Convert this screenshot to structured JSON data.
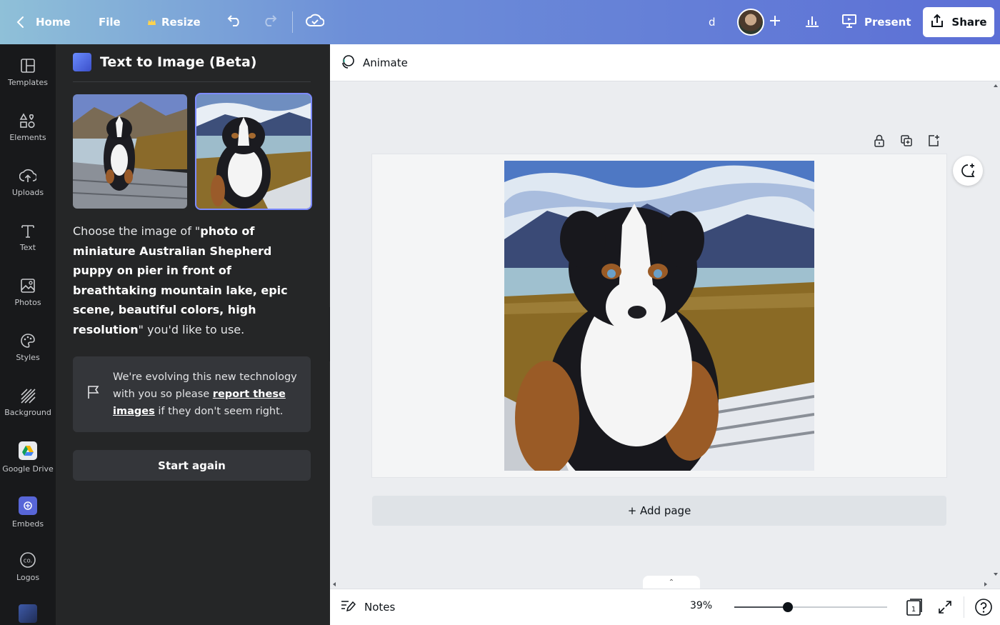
{
  "topbar": {
    "home": "Home",
    "file": "File",
    "resize": "Resize",
    "collaborator_initial": "d",
    "present": "Present",
    "share": "Share"
  },
  "rail": {
    "items": [
      {
        "label": "Templates",
        "icon": "templates-icon"
      },
      {
        "label": "Elements",
        "icon": "elements-icon"
      },
      {
        "label": "Uploads",
        "icon": "uploads-icon"
      },
      {
        "label": "Text",
        "icon": "text-icon"
      },
      {
        "label": "Photos",
        "icon": "photos-icon"
      },
      {
        "label": "Styles",
        "icon": "styles-icon"
      },
      {
        "label": "Background",
        "icon": "background-icon"
      },
      {
        "label": "Google Drive",
        "icon": "google-drive-icon"
      },
      {
        "label": "Embeds",
        "icon": "embeds-icon"
      },
      {
        "label": "Logos",
        "icon": "logos-icon"
      }
    ]
  },
  "panel": {
    "title": "Text to Image (Beta)",
    "prompt_prefix": "Choose the image of \"",
    "prompt": "photo of miniature Australian Shepherd puppy on pier in front of breathtaking mountain lake, epic scene, beautiful colors, high resolution",
    "prompt_suffix": "\" you'd like to use.",
    "notice_prefix": "We're evolving this new technology with you so please ",
    "notice_link": "report these images",
    "notice_suffix": " if they don't seem right.",
    "start_again": "Start again"
  },
  "editor": {
    "animate": "Animate",
    "add_page": "+ Add page",
    "notes": "Notes",
    "zoom": "39%",
    "zoom_fraction": 0.35,
    "page_number": "1"
  },
  "colors": {
    "accent": "#7d8bff",
    "panel_bg": "#252627",
    "rail_bg": "#18191b"
  }
}
